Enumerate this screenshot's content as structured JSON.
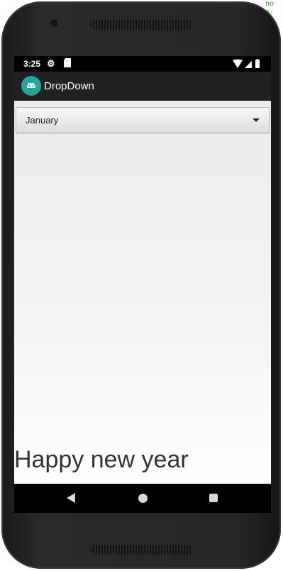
{
  "status_bar": {
    "time": "3:25",
    "icons": [
      "gear-icon",
      "sd-card-icon",
      "wifi-icon",
      "signal-icon",
      "battery-icon"
    ]
  },
  "action_bar": {
    "title": "DropDown",
    "icon": "android-icon",
    "icon_color": "#26a69a"
  },
  "spinner": {
    "selected": "January",
    "icon": "chevron-down-icon"
  },
  "content": {
    "message": "Happy new year"
  },
  "navigation": {
    "back": "back-icon",
    "home": "home-icon",
    "recents": "recents-icon"
  },
  "colors": {
    "status_bar_bg": "#000000",
    "action_bar_bg": "#212121",
    "content_bg": "#f3f3f3",
    "text": "#333333"
  }
}
